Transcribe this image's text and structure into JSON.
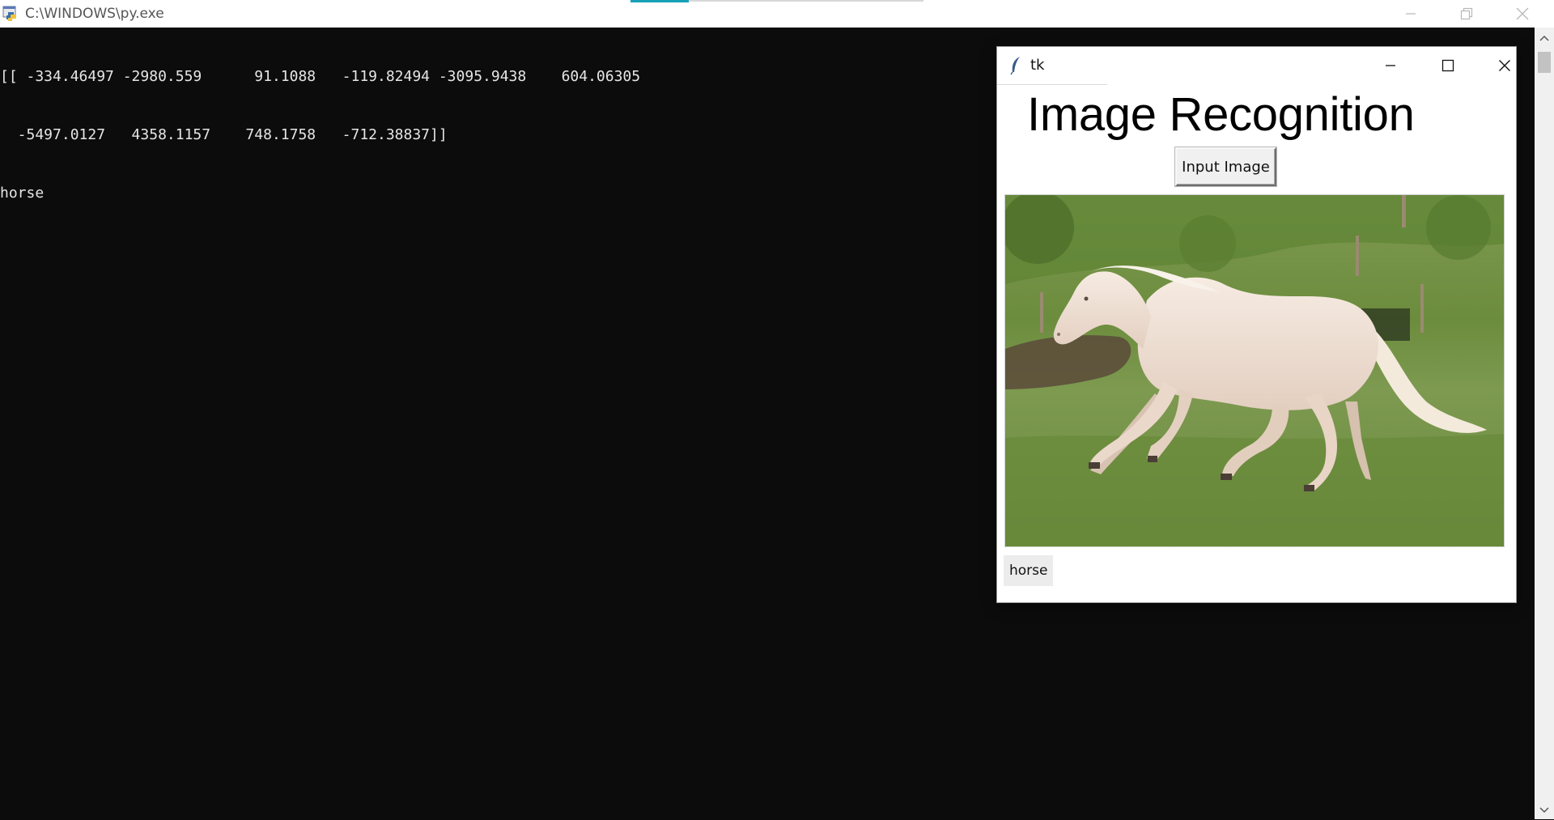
{
  "console": {
    "title": "C:\\WINDOWS\\py.exe",
    "lines": [
      "[[ -334.46497 -2980.559      91.1088   -119.82494 -3095.9438    604.06305",
      "  -5497.0127   4358.1157    748.1758   -712.38837]]",
      "horse"
    ]
  },
  "tk": {
    "title": "tk",
    "heading": "Image Recognition",
    "button_label": "Input Image",
    "result": "horse",
    "image_subject": "white-horse-galloping-on-grass"
  },
  "icons": {
    "console_app": "python-launcher-icon",
    "tk_app": "tk-feather-icon"
  },
  "colors": {
    "console_bg": "#0c0c0c",
    "console_text": "#e6e6e6",
    "tab_accent": "#16a2b8"
  }
}
